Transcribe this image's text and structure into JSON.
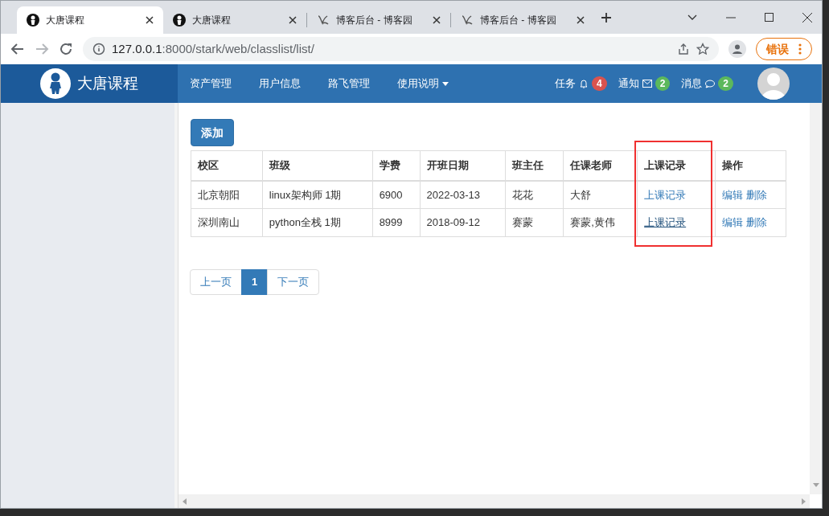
{
  "browser": {
    "tabs": [
      {
        "title": "大唐课程",
        "kind": "kid",
        "selected": true
      },
      {
        "title": "大唐课程",
        "kind": "kid",
        "selected": false
      },
      {
        "title": "博客后台 - 博客园",
        "kind": "blog",
        "selected": false
      },
      {
        "title": "博客后台 - 博客园",
        "kind": "blog",
        "selected": false
      }
    ],
    "url_host": "127.0.0.1",
    "url_rest": ":8000/stark/web/classlist/list/",
    "error_button": "错误"
  },
  "navbar": {
    "brand": "大唐课程",
    "menu": [
      {
        "label": "资产管理",
        "dropdown": false
      },
      {
        "label": "用户信息",
        "dropdown": false
      },
      {
        "label": "路飞管理",
        "dropdown": false
      },
      {
        "label": "使用说明",
        "dropdown": true
      }
    ],
    "notices": [
      {
        "label": "任务",
        "kind": "bell",
        "count": "4",
        "color": "#d9534f"
      },
      {
        "label": "通知",
        "kind": "mail",
        "count": "2",
        "color": "#5cb85c"
      },
      {
        "label": "消息",
        "kind": "chat",
        "count": "2",
        "color": "#5cb85c"
      }
    ]
  },
  "add_button": "添加",
  "table": {
    "columns": [
      {
        "label": "校区",
        "highlighted": false
      },
      {
        "label": "班级",
        "highlighted": false
      },
      {
        "label": "学费",
        "highlighted": false
      },
      {
        "label": "开班日期",
        "highlighted": false
      },
      {
        "label": "班主任",
        "highlighted": false
      },
      {
        "label": "任课老师",
        "highlighted": false
      },
      {
        "label": "上课记录",
        "highlighted": true
      },
      {
        "label": "操作",
        "highlighted": false
      }
    ],
    "rows": [
      {
        "cells": [
          "北京朝阳",
          "linux架构师 1期",
          "6900",
          "2022-03-13",
          "花花",
          "大舒"
        ],
        "record_link": {
          "label": "上课记录",
          "hovered": false
        },
        "actions": [
          "编辑",
          "删除"
        ]
      },
      {
        "cells": [
          "深圳南山",
          "python全栈 1期",
          "8999",
          "2018-09-12",
          "赛蒙",
          "赛蒙,黄伟"
        ],
        "record_link": {
          "label": "上课记录",
          "hovered": true
        },
        "actions": [
          "编辑",
          "删除"
        ]
      }
    ]
  },
  "pagination": [
    {
      "label": "上一页",
      "selected": false
    },
    {
      "label": "1",
      "selected": true
    },
    {
      "label": "下一页",
      "selected": false
    }
  ]
}
